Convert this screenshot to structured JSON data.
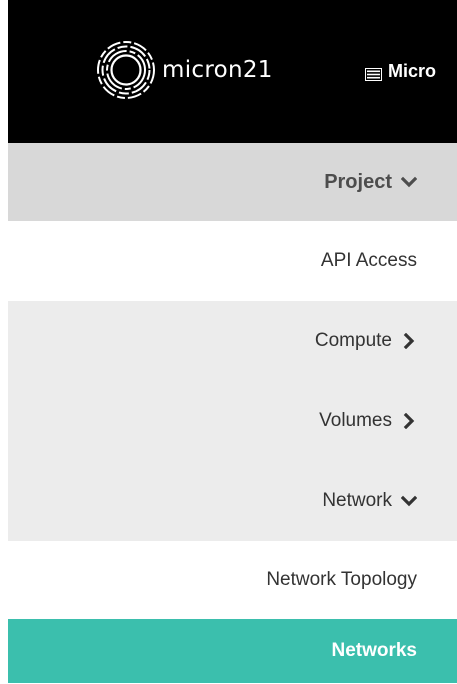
{
  "header": {
    "logo_text": "micron21",
    "project_switch_label": "Micro",
    "project_switch_icon": "list-icon"
  },
  "sidebar": {
    "section": {
      "label": "Project",
      "icon": "chevron-down-icon"
    },
    "items": [
      {
        "label": "API Access"
      },
      {
        "label": "Compute",
        "icon": "chevron-right-icon"
      },
      {
        "label": "Volumes",
        "icon": "chevron-right-icon"
      },
      {
        "label": "Network",
        "icon": "chevron-down-icon"
      },
      {
        "label": "Network Topology"
      },
      {
        "label": "Networks",
        "active": true
      }
    ]
  },
  "colors": {
    "topbar": "#000000",
    "section_header_bg": "#d8d8d8",
    "group_bg": "#ececec",
    "active_bg": "#3bbfad",
    "active_text": "#ffffff",
    "text": "#333333"
  }
}
